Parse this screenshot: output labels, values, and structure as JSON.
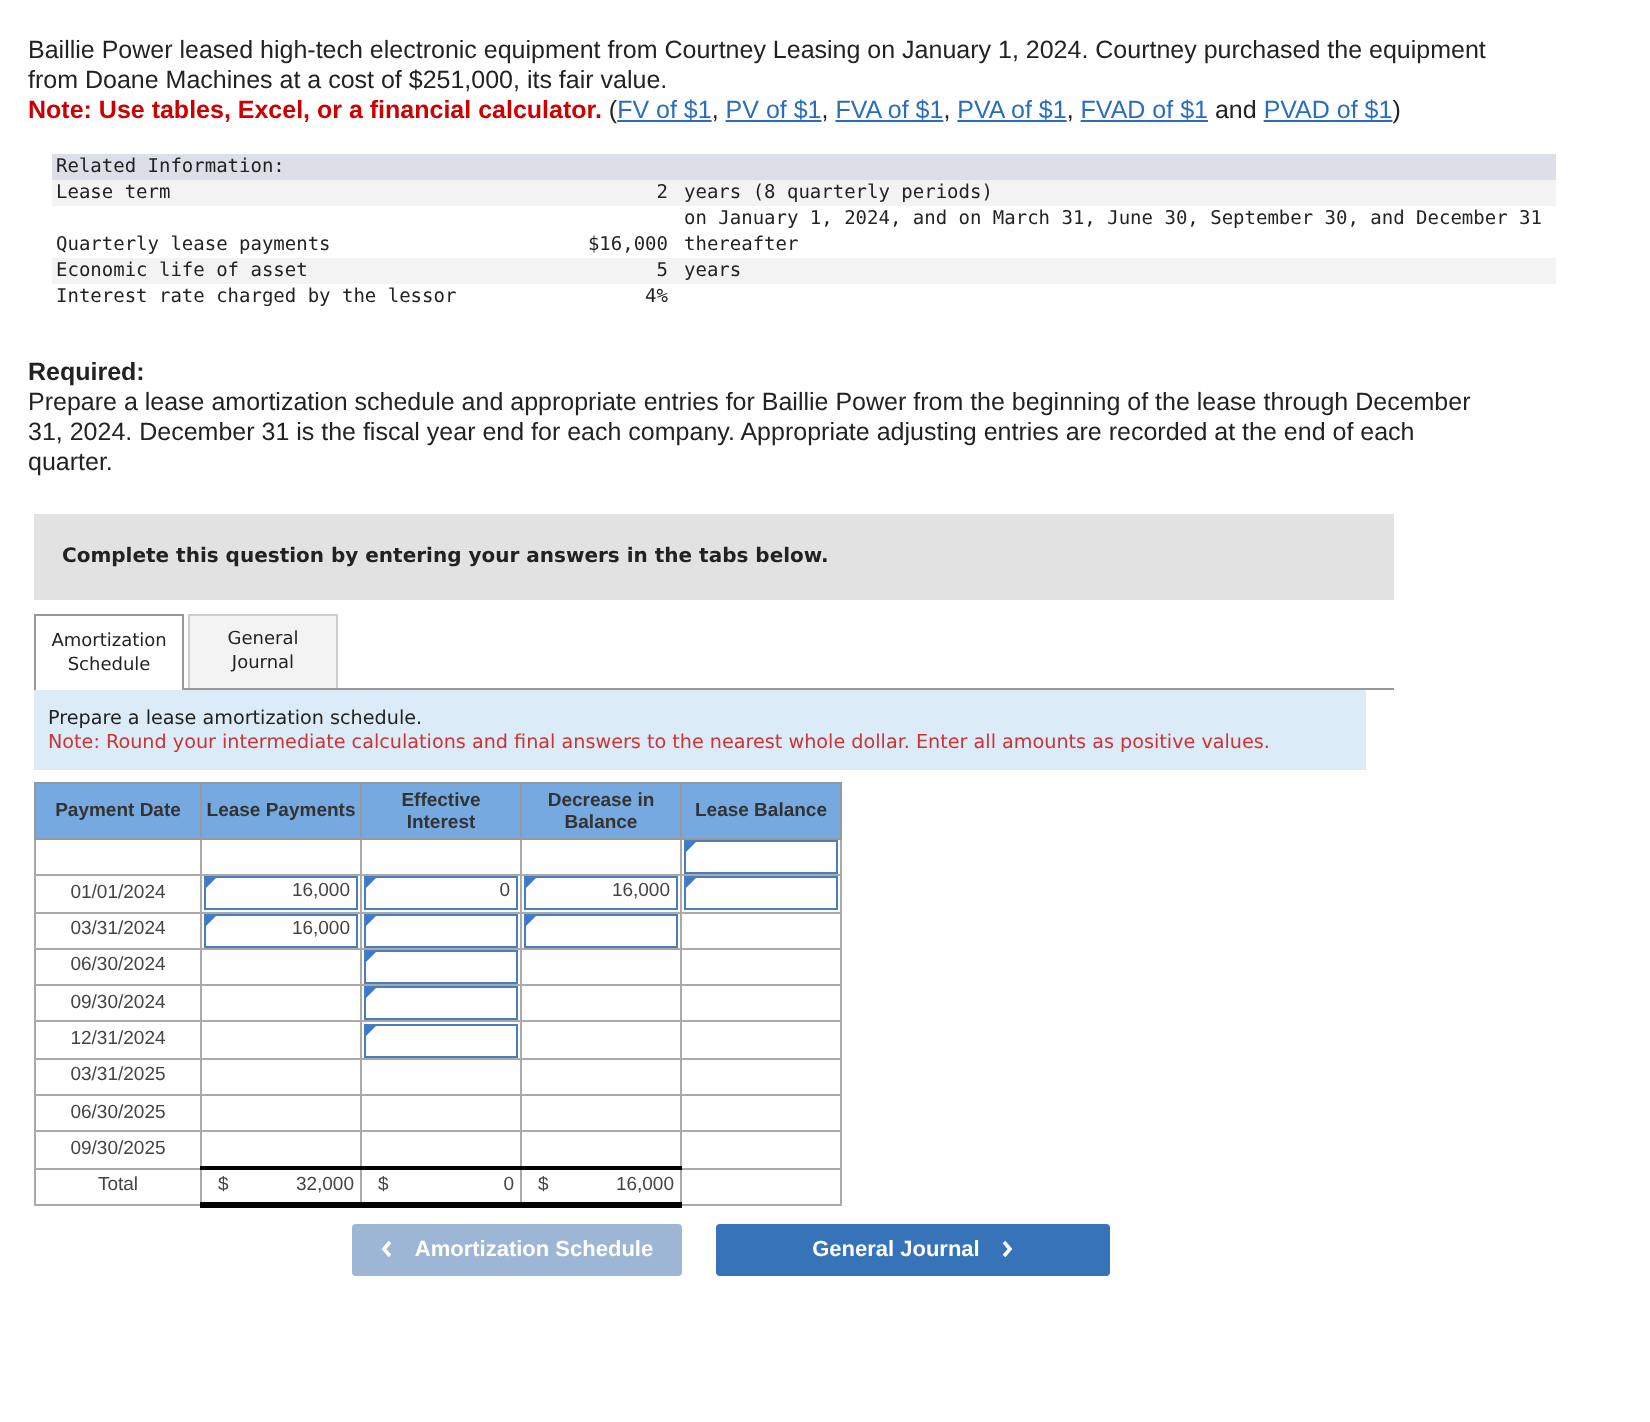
{
  "intro": {
    "text": "Baillie Power leased high-tech electronic equipment from Courtney Leasing on January 1, 2024. Courtney purchased the equipment from Doane Machines at a cost of $251,000, its fair value.",
    "note": "Note: Use tables, Excel, or a financial calculator.",
    "open": "(",
    "links": [
      {
        "text": "FV of $1",
        "sep": ","
      },
      {
        "text": "PV of $1",
        "sep": ","
      },
      {
        "text": "FVA of $1",
        "sep": ","
      },
      {
        "text": "PVA of $1",
        "sep": ","
      },
      {
        "text": "FVAD of $1"
      },
      {
        "text": "PVAD of $1"
      }
    ],
    "joiner": "and",
    "close": ")"
  },
  "related": {
    "title": "Related Information:",
    "rows": [
      {
        "label": "Lease term",
        "value": "2",
        "lines": [
          "years (8 quarterly periods)"
        ]
      },
      {
        "label": "Quarterly lease payments",
        "value": "$16,000",
        "lines": [
          "on January 1, 2024, and on March 31, June 30, September 30, and December 31",
          "thereafter"
        ]
      },
      {
        "label": "Economic life of asset",
        "value": "5",
        "lines": [
          "years"
        ]
      },
      {
        "label": "Interest rate charged by the lessor",
        "value": "4%",
        "lines": []
      }
    ]
  },
  "required": {
    "heading": "Required:",
    "text": "Prepare a lease amortization schedule and appropriate entries for Baillie Power from the beginning of the lease through December 31, 2024. December 31 is the fiscal year end for each company. Appropriate adjusting entries are recorded at the end of each quarter."
  },
  "instruction": "Complete this question by entering your answers in the tabs below.",
  "tabs": [
    {
      "label": "Amortization Schedule",
      "selected": true
    },
    {
      "label": "General Journal",
      "selected": false
    }
  ],
  "panel": {
    "text": "Prepare a lease amortization schedule.",
    "note": "Note: Round your intermediate calculations and final answers to the nearest whole dollar. Enter all amounts as positive values."
  },
  "table": {
    "columns": [
      "Payment Date",
      "Lease Payments",
      "Effective Interest",
      "Decrease in Balance",
      "Lease Balance"
    ],
    "rows": [
      {
        "cells": [
          {
            "kind": "blank"
          },
          {
            "kind": "blank"
          },
          {
            "kind": "blank"
          },
          {
            "kind": "blank"
          },
          {
            "kind": "input"
          }
        ]
      },
      {
        "cells": [
          {
            "kind": "text",
            "value": "01/01/2024"
          },
          {
            "kind": "input",
            "value": "16,000"
          },
          {
            "kind": "input",
            "value": "0"
          },
          {
            "kind": "input",
            "value": "16,000"
          },
          {
            "kind": "input"
          }
        ]
      },
      {
        "cells": [
          {
            "kind": "text",
            "value": "03/31/2024"
          },
          {
            "kind": "input",
            "value": "16,000"
          },
          {
            "kind": "input"
          },
          {
            "kind": "input"
          },
          {
            "kind": "blank"
          }
        ]
      },
      {
        "cells": [
          {
            "kind": "text",
            "value": "06/30/2024"
          },
          {
            "kind": "blank"
          },
          {
            "kind": "input"
          },
          {
            "kind": "blank"
          },
          {
            "kind": "blank"
          }
        ]
      },
      {
        "cells": [
          {
            "kind": "text",
            "value": "09/30/2024"
          },
          {
            "kind": "blank"
          },
          {
            "kind": "input"
          },
          {
            "kind": "blank"
          },
          {
            "kind": "blank"
          }
        ]
      },
      {
        "cells": [
          {
            "kind": "text",
            "value": "12/31/2024"
          },
          {
            "kind": "blank"
          },
          {
            "kind": "input"
          },
          {
            "kind": "blank"
          },
          {
            "kind": "blank"
          }
        ]
      },
      {
        "cells": [
          {
            "kind": "text",
            "value": "03/31/2025"
          },
          {
            "kind": "blank"
          },
          {
            "kind": "blank"
          },
          {
            "kind": "blank"
          },
          {
            "kind": "blank"
          }
        ]
      },
      {
        "cells": [
          {
            "kind": "text",
            "value": "06/30/2025"
          },
          {
            "kind": "blank"
          },
          {
            "kind": "blank"
          },
          {
            "kind": "blank"
          },
          {
            "kind": "blank"
          }
        ]
      },
      {
        "cells": [
          {
            "kind": "text",
            "value": "09/30/2025"
          },
          {
            "kind": "blank"
          },
          {
            "kind": "blank"
          },
          {
            "kind": "blank"
          },
          {
            "kind": "blank"
          }
        ]
      },
      {
        "total": true,
        "cells": [
          {
            "kind": "text",
            "value": "Total"
          },
          {
            "kind": "total",
            "currency": "$",
            "value": "32,000"
          },
          {
            "kind": "total",
            "currency": "$",
            "value": "0"
          },
          {
            "kind": "total",
            "currency": "$",
            "value": "16,000"
          },
          {
            "kind": "blank"
          }
        ]
      }
    ]
  },
  "buttons": [
    {
      "label": "Amortization Schedule",
      "kind": "prev",
      "disabled": true
    },
    {
      "label": "General Journal",
      "kind": "next",
      "disabled": false
    }
  ]
}
